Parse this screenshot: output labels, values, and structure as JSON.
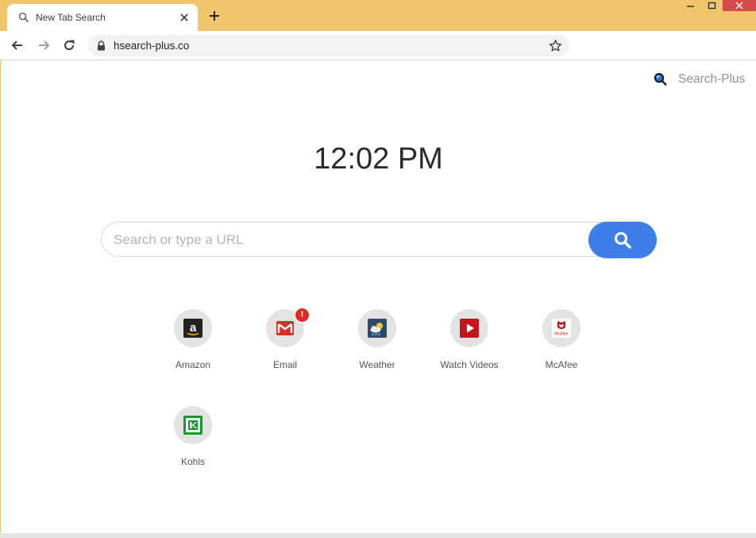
{
  "browser": {
    "tab_title": "New Tab Search",
    "url": "hsearch-plus.co"
  },
  "page": {
    "brand_name": "Search-Plus",
    "clock": "12:02 PM",
    "search_placeholder": "Search or type a URL",
    "tiles": [
      {
        "label": "Amazon",
        "icon": "amazon-icon"
      },
      {
        "label": "Email",
        "icon": "email-icon",
        "badge": "!"
      },
      {
        "label": "Weather",
        "icon": "weather-icon"
      },
      {
        "label": "Watch Videos",
        "icon": "video-play-icon"
      },
      {
        "label": "McAfee",
        "icon": "mcafee-icon",
        "icon_text": "McAfee"
      },
      {
        "label": "Kohls",
        "icon": "kohls-icon"
      }
    ]
  },
  "colors": {
    "frame": "#f1c56b",
    "search_button": "#3d7fe6",
    "close_button": "#d74a4a"
  }
}
